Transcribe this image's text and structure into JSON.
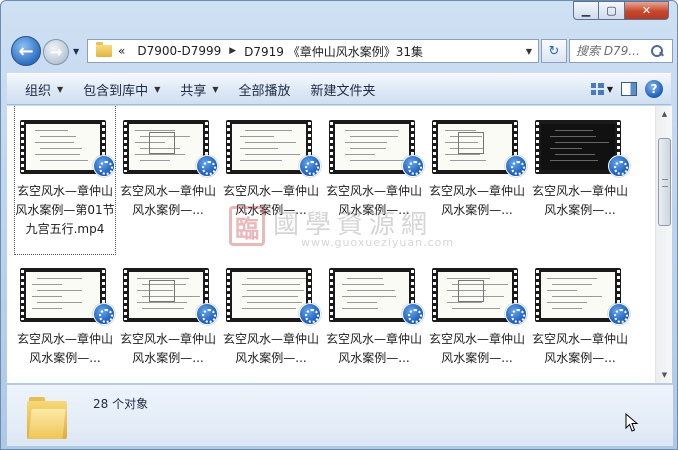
{
  "window": {
    "controls": {
      "minimize": "▁",
      "maximize": "▢",
      "close": "✕"
    }
  },
  "nav": {
    "back_icon": "back-arrow-icon",
    "forward_icon": "forward-arrow-icon",
    "crumb_prefix": "«",
    "breadcrumb": [
      "D7900-D7999",
      "D7919 《章仲山风水案例》31集"
    ],
    "search_placeholder": "搜索 D79...",
    "refresh_icon": "↻"
  },
  "commands": [
    {
      "label": "组织",
      "has_menu": true
    },
    {
      "label": "包含到库中",
      "has_menu": true
    },
    {
      "label": "共享",
      "has_menu": true
    },
    {
      "label": "全部播放",
      "has_menu": false
    },
    {
      "label": "新建文件夹",
      "has_menu": false
    }
  ],
  "help_label": "?",
  "files": [
    {
      "label": "玄空风水—章仲山风水案例—第01节九宫五行.mp4",
      "selected": true,
      "style": "light"
    },
    {
      "label": "玄空风水—章仲山风水案例—...",
      "selected": false,
      "style": "light"
    },
    {
      "label": "玄空风水—章仲山风水案例—...",
      "selected": false,
      "style": "light"
    },
    {
      "label": "玄空风水—章仲山风水案例—...",
      "selected": false,
      "style": "light"
    },
    {
      "label": "玄空风水—章仲山风水案例—...",
      "selected": false,
      "style": "light"
    },
    {
      "label": "玄空风水—章仲山风水案例—...",
      "selected": false,
      "style": "dark"
    },
    {
      "label": "玄空风水—章仲山风水案例—...",
      "selected": false,
      "style": "light"
    },
    {
      "label": "玄空风水—章仲山风水案例—...",
      "selected": false,
      "style": "light"
    },
    {
      "label": "玄空风水—章仲山风水案例—...",
      "selected": false,
      "style": "light"
    },
    {
      "label": "玄空风水—章仲山风水案例—...",
      "selected": false,
      "style": "light"
    },
    {
      "label": "玄空风水—章仲山风水案例—...",
      "selected": false,
      "style": "light"
    },
    {
      "label": "玄空风水—章仲山风水案例—...",
      "selected": false,
      "style": "light"
    }
  ],
  "watermark": {
    "seal": "臨",
    "text": "國學資源網",
    "url": "www.guoxueziyuan.com"
  },
  "status": {
    "count_text": "28 个对象"
  }
}
